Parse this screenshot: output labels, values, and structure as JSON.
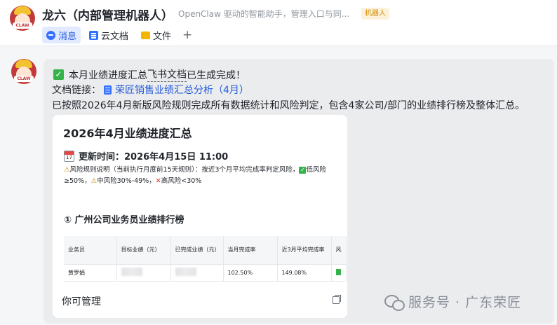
{
  "header": {
    "avatar_label": "CLAW",
    "title": "龙六（内部管理机器人）",
    "subtitle": "OpenClaw 驱动的智能助手，管理入口与同...",
    "badge": "机器人",
    "tabs": [
      {
        "label": "消息",
        "icon": "message-icon",
        "active": true
      },
      {
        "label": "云文档",
        "icon": "cloud-doc-icon",
        "active": false
      },
      {
        "label": "文件",
        "icon": "folder-icon",
        "active": false
      }
    ],
    "add_tab": "+"
  },
  "message": {
    "avatar_label": "CLAW",
    "line1_prefix": "本月业绩进度汇总",
    "line1_feishu": "飞书文档",
    "line1_suffix": "已生成完成！",
    "doc_link_label": "文档链接：",
    "doc_link_text": "荣匠销售业绩汇总分析（4月）",
    "summary": "已按照2026年4月新版风险规则完成所有数据统计和风险判定，包含4家公司/部门的业绩排行榜及整体汇总。"
  },
  "doc_card": {
    "title": "2026年4月业绩进度汇总",
    "calendar_day": "17",
    "update_time": "更新时间：2026年4月15日 11:00",
    "rule_warn_icon": "⚠",
    "rule_text_1": "风险规则说明（当前执行月度前15天规则）：按近3个月平均完成率判定风险，",
    "rule_low": "低",
    "rule_text_2": "风险≥50%，",
    "rule_mid": "中风险30%-49%，",
    "rule_high": "高风险<30%",
    "section_title": "① 广州公司业务员业绩排行榜",
    "table": {
      "headers": [
        "业务员",
        "目标业绩（元）",
        "已完成业绩（元）",
        "当月完成率",
        "近3月平均完成率",
        "风"
      ],
      "rows": [
        {
          "name": "黄罗娟",
          "target": "",
          "done": "",
          "month_rate": "102.50%",
          "avg_rate": "149.08%"
        }
      ]
    },
    "footer_text": "你可管理"
  },
  "watermark": "服务号 · 广东荣匠",
  "colors": {
    "accent": "#245bdb",
    "success": "#35b34a",
    "warning": "#d08c0a",
    "danger": "#e02e24",
    "bubble_bg": "#ebecee"
  }
}
